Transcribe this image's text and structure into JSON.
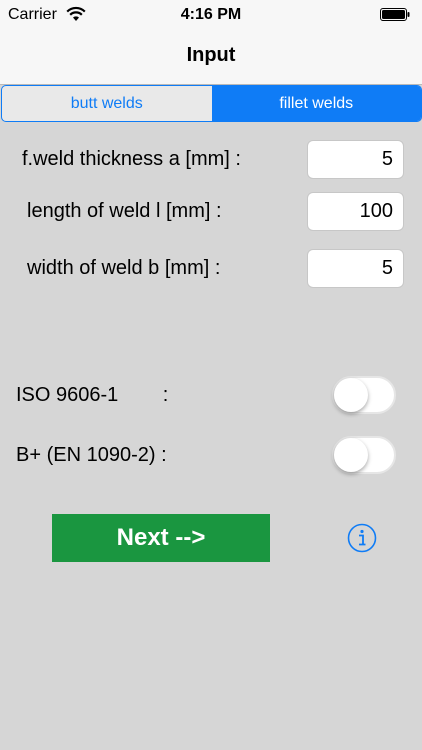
{
  "status": {
    "carrier": "Carrier",
    "time": "4:16 PM"
  },
  "nav": {
    "title": "Input"
  },
  "segments": [
    {
      "label": "butt welds",
      "selected": false
    },
    {
      "label": "fillet welds",
      "selected": true
    }
  ],
  "fields": {
    "thickness": {
      "label": "f.weld thickness a [mm] :",
      "value": "5"
    },
    "length": {
      "label": "length of weld l [mm] :",
      "value": "100"
    },
    "width": {
      "label": "width of weld b [mm] :",
      "value": "5"
    }
  },
  "toggles": {
    "iso": {
      "label": "ISO 9606-1        :",
      "on": false
    },
    "bplus": {
      "label": "B+ (EN 1090-2) :",
      "on": false
    }
  },
  "actions": {
    "next_label": "Next  -->",
    "info_icon": "info-circle-icon"
  },
  "colors": {
    "accent": "#0f7cf6",
    "next_button": "#1a9640",
    "background": "#d6d6d6"
  }
}
